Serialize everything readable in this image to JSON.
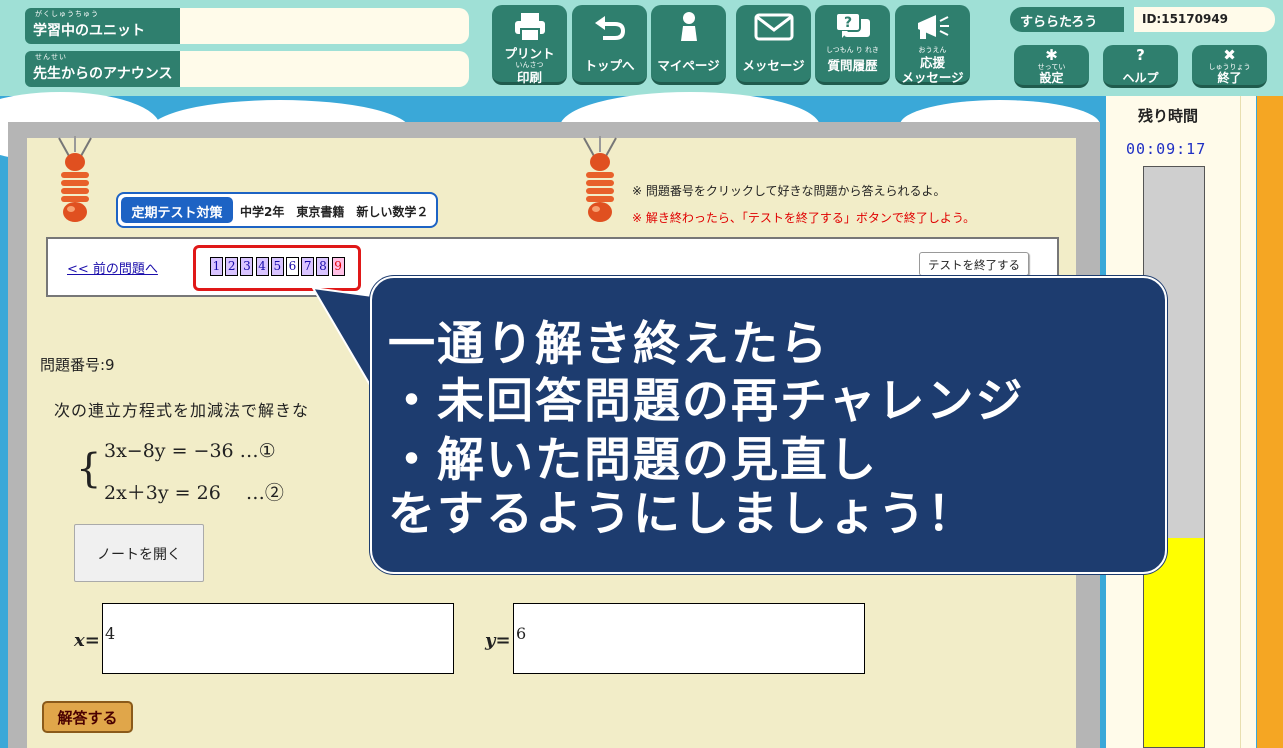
{
  "header": {
    "unit_label": "学習中のユニット",
    "unit_ruby": "がくしゅうちゅう",
    "unit_value": "",
    "announce_label": "先生からのアナウンス",
    "announce_ruby": "せんせい",
    "announce_value": ""
  },
  "nav": [
    {
      "l1": "プリント",
      "ruby": "いんさつ",
      "l2": "印刷",
      "icon": "printer-icon"
    },
    {
      "l1": "トップへ",
      "icon": "return-arrow-icon"
    },
    {
      "l1": "マイページ",
      "icon": "person-icon"
    },
    {
      "l1": "メッセージ",
      "icon": "envelope-icon"
    },
    {
      "l1": "質問履歴",
      "ruby": "しつもん り れき",
      "icon": "question-bubble-icon"
    },
    {
      "l1": "応援",
      "ruby": "おうえん",
      "l2": "メッセージ",
      "icon": "megaphone-icon"
    }
  ],
  "user": {
    "name": "すららたろう",
    "id": "ID:15170949"
  },
  "system_buttons": [
    {
      "symbol": "✱",
      "ruby": "せってい",
      "label": "設定",
      "icon": "gear-icon"
    },
    {
      "symbol": "?",
      "label": "ヘルプ",
      "icon": "help-icon"
    },
    {
      "symbol": "✖",
      "ruby": "しゅうりょう",
      "label": "終了",
      "icon": "close-icon"
    }
  ],
  "test": {
    "tag": "定期テスト対策",
    "subject": "中学2年　東京書籍　新しい数学２",
    "notice_1": "※ 問題番号をクリックして好きな問題から答えられるよ。",
    "notice_2": "※ 解き終わったら、「テストを終了する」ボタンで終了しよう。",
    "prev_link": "<< 前の問題へ",
    "question_numbers": [
      "1",
      "2",
      "3",
      "4",
      "5",
      "6",
      "7",
      "8",
      "9"
    ],
    "answered": [
      "1",
      "2",
      "3",
      "4",
      "5",
      "7",
      "8"
    ],
    "current": "9",
    "end_button": "テストを終了する"
  },
  "question": {
    "number_label": "問題番号:9",
    "text": "次の連立方程式を加減法で解きな",
    "eq1": "3x−8y = −36 …①",
    "eq2": "2x＋3y = 26 　…②",
    "note_button": "ノートを開く",
    "x_label": "x=",
    "x_value": "4",
    "y_label": "y=",
    "y_value": "6",
    "submit_button": "解答する"
  },
  "timer": {
    "label": "残り時間",
    "value": "00:09:17",
    "remaining_fraction": 0.36
  },
  "callout": {
    "line1": "一通り解き終えたら",
    "line2": "・未回答問題の再チャレンジ",
    "line3": "・解いた問題の見直し",
    "line4": "をするようにしましょう！"
  },
  "colors": {
    "header_bg": "#9fe0d6",
    "button_green": "#2f7f6e",
    "panel_bg": "#f2edc8",
    "callout_bg": "#1d3c6f",
    "highlight_red": "#e01818",
    "timer_fill": "#ffff00"
  }
}
